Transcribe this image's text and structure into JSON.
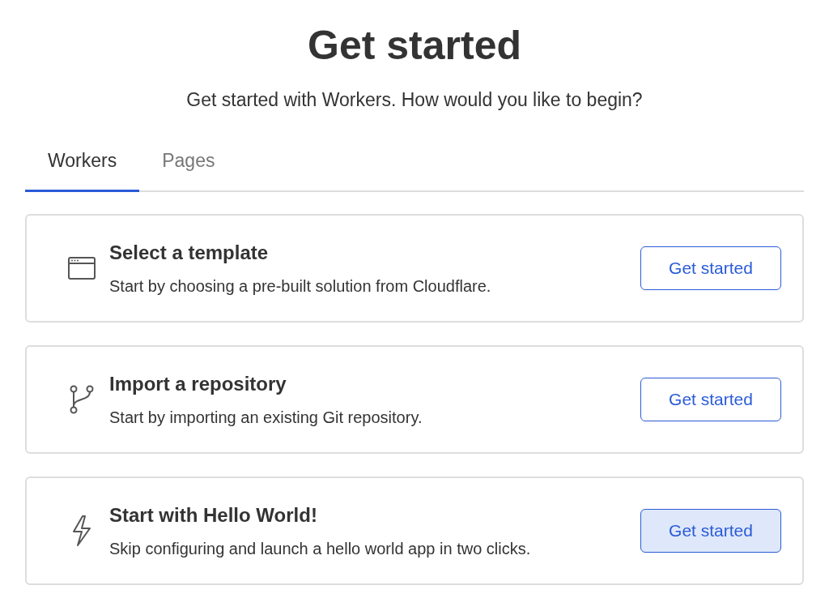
{
  "title": "Get started",
  "subtitle": "Get started with Workers. How would you like to begin?",
  "tabs": [
    {
      "label": "Workers",
      "selected": true
    },
    {
      "label": "Pages",
      "selected": false
    }
  ],
  "options": [
    {
      "kind": "template",
      "title": "Select a template",
      "description": "Start by choosing a pre-built solution from Cloudflare.",
      "button": "Get started",
      "highlighted": false
    },
    {
      "kind": "repository",
      "title": "Import a repository",
      "description": "Start by importing an existing Git repository.",
      "button": "Get started",
      "highlighted": false
    },
    {
      "kind": "hello",
      "title": "Start with Hello World!",
      "description": "Skip configuring and launch a hello world app in two clicks.",
      "button": "Get started",
      "highlighted": true
    }
  ]
}
